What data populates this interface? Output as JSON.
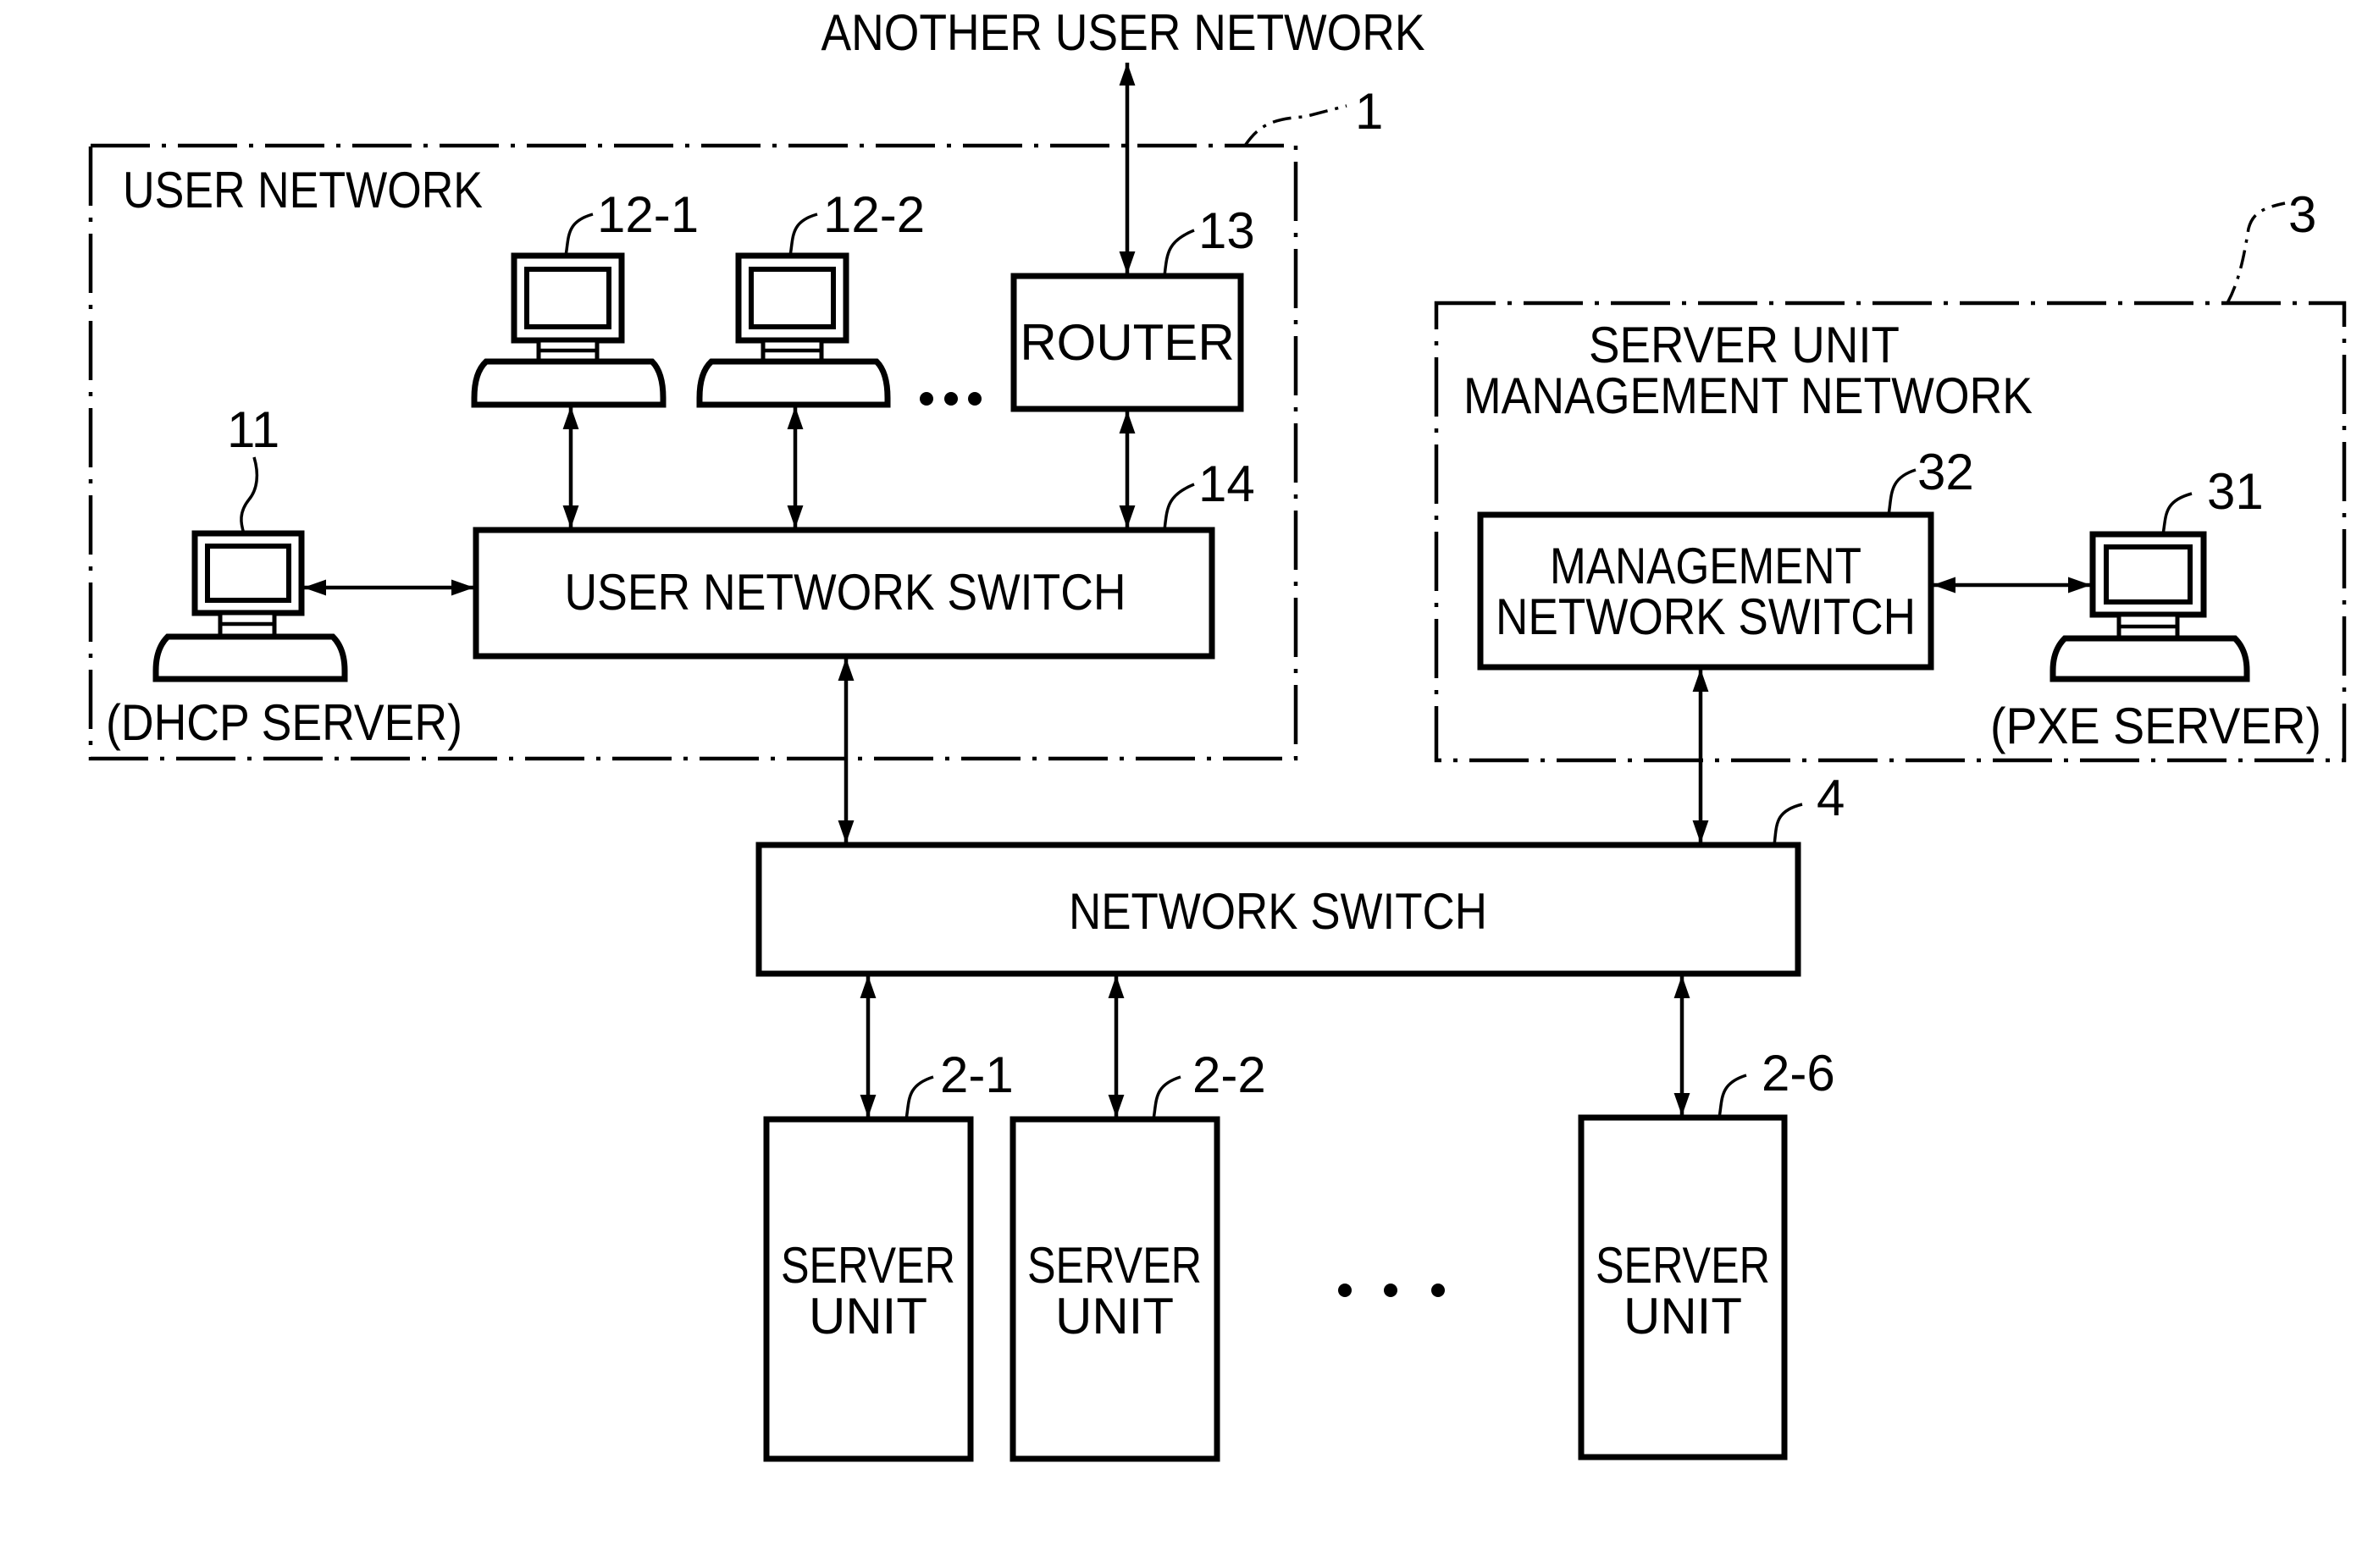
{
  "figure": {
    "external_network_label": "ANOTHER USER NETWORK",
    "user_network": {
      "ref": "1",
      "title": "USER NETWORK",
      "dhcp_server": {
        "ref": "11",
        "caption": "(DHCP SERVER)",
        "icon": "computer-icon"
      },
      "user_terminals": [
        {
          "ref": "12-1",
          "icon": "computer-icon"
        },
        {
          "ref": "12-2",
          "icon": "computer-icon"
        }
      ],
      "terminals_ellipsis": "•••",
      "router": {
        "ref": "13",
        "label": "ROUTER"
      },
      "user_network_switch": {
        "ref": "14",
        "label": "USER NETWORK SWITCH"
      }
    },
    "management_network": {
      "ref": "3",
      "title_line1": "SERVER UNIT",
      "title_line2": "MANAGEMENT NETWORK",
      "management_switch": {
        "ref": "32",
        "label_line1": "MANAGEMENT",
        "label_line2": "NETWORK SWITCH"
      },
      "pxe_server": {
        "ref": "31",
        "caption": "(PXE SERVER)",
        "icon": "computer-icon"
      }
    },
    "network_switch": {
      "ref": "4",
      "label": "NETWORK SWITCH"
    },
    "server_units": [
      {
        "ref": "2-1",
        "label_line1": "SERVER",
        "label_line2": "UNIT"
      },
      {
        "ref": "2-2",
        "label_line1": "SERVER",
        "label_line2": "UNIT"
      },
      {
        "ref": "2-6",
        "label_line1": "SERVER",
        "label_line2": "UNIT"
      }
    ],
    "servers_ellipsis": "• • •",
    "connections": [
      {
        "from": "ANOTHER USER NETWORK",
        "to": "ROUTER",
        "type": "bidirectional"
      },
      {
        "from": "ROUTER",
        "to": "USER NETWORK SWITCH",
        "type": "bidirectional"
      },
      {
        "from": "12-1",
        "to": "USER NETWORK SWITCH",
        "type": "bidirectional"
      },
      {
        "from": "12-2",
        "to": "USER NETWORK SWITCH",
        "type": "bidirectional"
      },
      {
        "from": "DHCP SERVER",
        "to": "USER NETWORK SWITCH",
        "type": "bidirectional"
      },
      {
        "from": "USER NETWORK SWITCH",
        "to": "NETWORK SWITCH",
        "type": "bidirectional"
      },
      {
        "from": "MANAGEMENT NETWORK SWITCH",
        "to": "PXE SERVER",
        "type": "bidirectional"
      },
      {
        "from": "MANAGEMENT NETWORK SWITCH",
        "to": "NETWORK SWITCH",
        "type": "bidirectional"
      },
      {
        "from": "NETWORK SWITCH",
        "to": "2-1",
        "type": "bidirectional"
      },
      {
        "from": "NETWORK SWITCH",
        "to": "2-2",
        "type": "bidirectional"
      },
      {
        "from": "NETWORK SWITCH",
        "to": "2-6",
        "type": "bidirectional"
      }
    ]
  }
}
